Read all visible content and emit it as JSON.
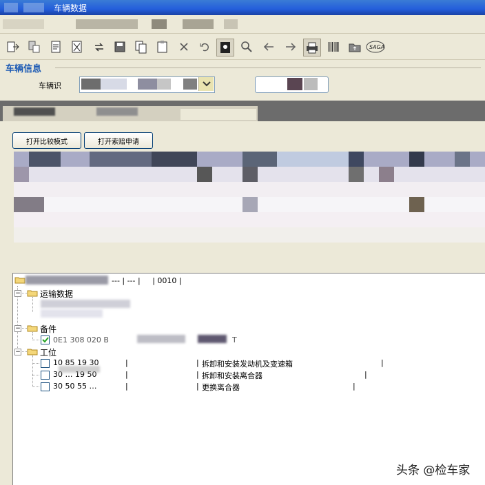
{
  "window": {
    "title": "车辆数据"
  },
  "vehicle_info": {
    "section_label": "车辆信息",
    "field_label": "车辆识"
  },
  "buttons": {
    "compare_mode": "打开比较模式",
    "warranty_claim": "打开索赔申请"
  },
  "tree": {
    "root_text": "--- | --- |     | 0010 |",
    "transport": {
      "label": "运输数据"
    },
    "parts": {
      "label": "备件",
      "item_code": "0E1 308 020 B",
      "item_checked": true,
      "item_tail": "T"
    },
    "positions": {
      "label": "工位",
      "items": [
        {
          "code": "10 85 19 30",
          "desc": "拆卸和安装发动机及变速箱"
        },
        {
          "code": "30 … 19 50",
          "desc": "拆卸和安装离合器"
        },
        {
          "code": "30 50 55 …",
          "desc": "更换离合器"
        }
      ]
    }
  },
  "watermark": "头条 @检车家"
}
